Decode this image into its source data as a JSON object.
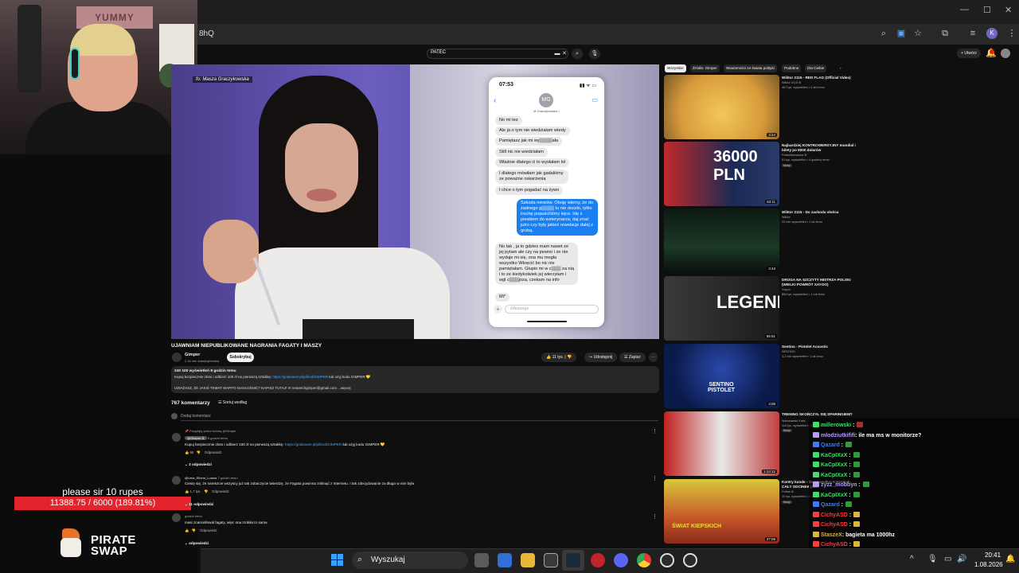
{
  "browser": {
    "url": "8hQ",
    "icons": [
      "zoom-icon",
      "extension-active-icon",
      "bookmark-star-icon",
      "extensions-icon",
      "media-control-icon"
    ],
    "profile_initial": "K",
    "window_controls": {
      "minimize": "—",
      "maximize": "☐",
      "close": "✕"
    }
  },
  "youtube_header": {
    "search_value": "PATEC",
    "create_label": "+ Utwórz"
  },
  "webcam": {
    "sign_text": "YUMMY YUMMY"
  },
  "overlay": {
    "donation_title": "please sir 10 rupes",
    "goal_text": "11388.75 / 6000 (189.81%)",
    "goal_fraction": 1.0,
    "logo_text_1": "PIRATE",
    "logo_text_2": "SWAP",
    "colors": {
      "goal_fill": "#e3242d",
      "logo_orange": "#e8722a"
    }
  },
  "video": {
    "credit": "fo: Masza Graczykowska",
    "title": "UJAWNIAM NIEPUBLIKOWANE NAGRANIA FAGATY I MASZY",
    "channel": "Gimper",
    "subscribers": "2,16 mln subskrybentów",
    "subscribe_label": "Subskrybuj",
    "likes": "11 tys.",
    "share_label": "Udostępnij",
    "save_label": "Zapisz",
    "description": {
      "line1": "240 100 wyświetleń  8 godzin temu",
      "line2_prefix": "Kupuj bezpiecznie złoto i odbierz 100 zł na pierwszą sztabkę:",
      "line2_link": "https://goldsaver.pl/pl/kod/GIMPER",
      "line2_suffix": "lub użyj kodu GIMPER 💛",
      "line3": "UWAŻASZ, ŻE JAKIŚ TEMAT WARTO NAGŁOŚNIĆ? NAPISZ TUTAJ! ✉ researchgimper@gmail.com ...więcej"
    }
  },
  "phone_chat": {
    "time": "07:53",
    "status": "▮▮ ᯤ ▭",
    "avatar_initials": "MG",
    "contact_name": "M Graczykowska ›",
    "messages": [
      {
        "dir": "in",
        "text": "No mi tez"
      },
      {
        "dir": "in",
        "text": "Ale ja o tym nie wiedziałam wtedy"
      },
      {
        "dir": "in",
        "text": "Pamiętasz jak mi wy▒▒▒▒ała"
      },
      {
        "dir": "in",
        "text": "Still nic nie wiedziałam"
      },
      {
        "dir": "in",
        "text": "Właśnie dlatego ci to wysłałam lol"
      },
      {
        "dir": "in",
        "text": "I dlatego mówiłam jak gadaliśmy ze poważne oskarżenia"
      },
      {
        "dir": "in",
        "text": "I chce o tym pogadać na żywo"
      },
      {
        "dir": "out",
        "text": "Szkoda nerwów. Oboję wiemy, że do żadnego g▒▒▒▒ tu nie doszło, tylko trochę popuściliśmy lejce. Idę z pieskiem do weterynarza, daj znać jutro czy były jakieś rewelacje dalej z grubą."
      },
      {
        "dir": "in",
        "text": "No tak , ja to gdzies mam nawet ze jej pytam ale czy na pewno i ze nie wydaje mi się, ona mu mogła wszystko Wkręcić bo nic nie pamiętałam. Głupio mi w c▒▒▒ za nią i to ze kiedykolwiek jej wierzyłam i wgl c▒▒▒joza, czekam na info"
      },
      {
        "dir": "in",
        "text": "Mi*"
      }
    ],
    "input_placeholder": "iMessage"
  },
  "comments": {
    "count": "767 komentarzy",
    "sort_label": "Sortuj według",
    "add_placeholder": "Dodaj komentarz",
    "items": [
      {
        "pinned": "📌 Przypięty przez twórcę @Gimper",
        "author": "@Gimper ⊛",
        "time": "8 godzin temu",
        "text_prefix": "Kupuj bezpiecznie złoto i odbierz 100 zł na pierwszą sztabkę:",
        "text_link": "https://goldsaver.pl/pl/kod/GIMPER",
        "text_suffix": "lub użyj kodu GIMPER 💛",
        "likes": "96",
        "reply_label": "Odpowiedz",
        "replies": "⌄ 3 odpowiedzi"
      },
      {
        "author": "@Uma_Elhem_Lumos",
        "time": "7 godzin temu",
        "text": "Ciesię się, że nareszcie wszyscy już tak zobaczycie twierdzę, że Fagata powinna zniknąć z Internetu. I tak zdecydowanie za długo w nim była",
        "likes": "1,7 tys.",
        "reply_label": "Odpowiedz",
        "replies": "⌄ 11 odpowiedzi"
      },
      {
        "author": "",
        "time": "godzin temu",
        "text": "masi zcancellowal fagaty, więc ona zrobiła to sama",
        "likes": "",
        "reply_label": "Odpowiedz",
        "replies": "⌄ odpowiedzi"
      }
    ]
  },
  "sidebar": {
    "chips": [
      "Wszystkie",
      "Źródło: Gimper",
      "Wiadomości ze świata polityki",
      "Podobne",
      "Dla Ciebie"
    ],
    "videos": [
      {
        "title": "Wiktor 2115 - RED FLAG (Official Video)",
        "channel": "Wiktor 2115 ⊛",
        "meta": "467 tys. wyświetleń • 4 dni temu",
        "duration": "3:24",
        "badge": ""
      },
      {
        "title": "Najbardziej KONTROWERSYJNY mundial i bilety po 8000 dolarów",
        "channel": "PolskiMaradona ⊛",
        "meta": "91 tys. wyświetleń • 4 godziny temu",
        "duration": "53:11",
        "badge": "Nowy",
        "big_text": "36000 PLN"
      },
      {
        "title": "Wiktor 2115 - Do zachodu słońca",
        "channel": "Wiktor",
        "meta": "23 mln wyświetleń • 1 lat temu",
        "duration": "3:43",
        "badge": ""
      },
      {
        "title": "DROGA NA SZCZYTY MISTRZA POLSKI (WIELKI POWRÓT XAYOO)",
        "channel": "Xayoo",
        "meta": "884 tys. wyświetleń • 1 rok temu",
        "duration": "55:51",
        "badge": "",
        "big_text": "LEGENDY"
      },
      {
        "title": "Sentino - Pistolet Acoustic",
        "channel": "SENTINO",
        "meta": "1,2 mln wyświetleń • 1 lat temu",
        "duration": "3:08",
        "badge": "",
        "big_text": "SENTINO PISTOLET"
      },
      {
        "title": "TRENING SKOŃCZYŁ SIĘ SPARINGIEM?",
        "channel": "Warszawski Koks",
        "meta": "114 tys. wyświetleń • 2 dni temu",
        "duration": "1:13:12",
        "badge": "Nowy"
      },
      {
        "title": "Kontry kunde - Świat według Kiepskich CAŁY ODCINEK [SI...",
        "channel": "Polsat ⊛",
        "meta": "10 tys. wyświetleń • 1 dzień temu",
        "duration": "27:09",
        "badge": "Nowy",
        "big_text": "ŚWIAT KIEPSKICH"
      }
    ]
  },
  "chat": {
    "lines": [
      {
        "user": "millerowski",
        "color": "#3be06b",
        "msg": "",
        "emote": "r"
      },
      {
        "user": "mlodziutkififi",
        "color": "#b59cff",
        "msg": ": ile ma ms w monitorze?",
        "emote": ""
      },
      {
        "user": "Qazard",
        "color": "#3a7bff",
        "msg": "",
        "emote": "g"
      },
      {
        "user": "KaCpIXxX",
        "color": "#3be06b",
        "msg": "",
        "emote": "g"
      },
      {
        "user": "KaCpIXxX",
        "color": "#3be06b",
        "msg": "",
        "emote": "g"
      },
      {
        "user": "KaCpIXxX",
        "color": "#3be06b",
        "msg": "",
        "emote": "g"
      },
      {
        "user": "zyzz_mobbyn",
        "color": "#b59cff",
        "msg": "",
        "emote": "g"
      },
      {
        "user": "KaCpIXxX",
        "color": "#3be06b",
        "msg": "",
        "emote": "g"
      },
      {
        "user": "Qazard",
        "color": "#3a7bff",
        "msg": "",
        "emote": "g"
      },
      {
        "user": "CichyASD",
        "color": "#ff3b3b",
        "msg": "",
        "emote": "y"
      },
      {
        "user": "CichyASD",
        "color": "#ff3b3b",
        "msg": "",
        "emote": "y"
      },
      {
        "user": "StaszeX",
        "color": "#e0b43a",
        "msg": ": bagieta ma 1000hz",
        "emote": ""
      },
      {
        "user": "CichyASD",
        "color": "#ff3b3b",
        "msg": "",
        "emote": "y"
      },
      {
        "user": "Karegin",
        "color": "#ff3b3b",
        "msg": "",
        "emote": "r"
      }
    ]
  },
  "taskbar": {
    "search_label": "Wyszukaj",
    "time": "20:41",
    "date": "1.08.2026",
    "apps": [
      "file-icon",
      "mail-icon",
      "folder-icon",
      "store-icon",
      "steam-icon",
      "app-red-icon",
      "discord-icon",
      "chrome-icon",
      "obs-icon",
      "obs2-icon"
    ],
    "tray": [
      "chevron-up-icon",
      "mic-icon",
      "network-icon",
      "volume-icon",
      "notification-icon"
    ]
  }
}
